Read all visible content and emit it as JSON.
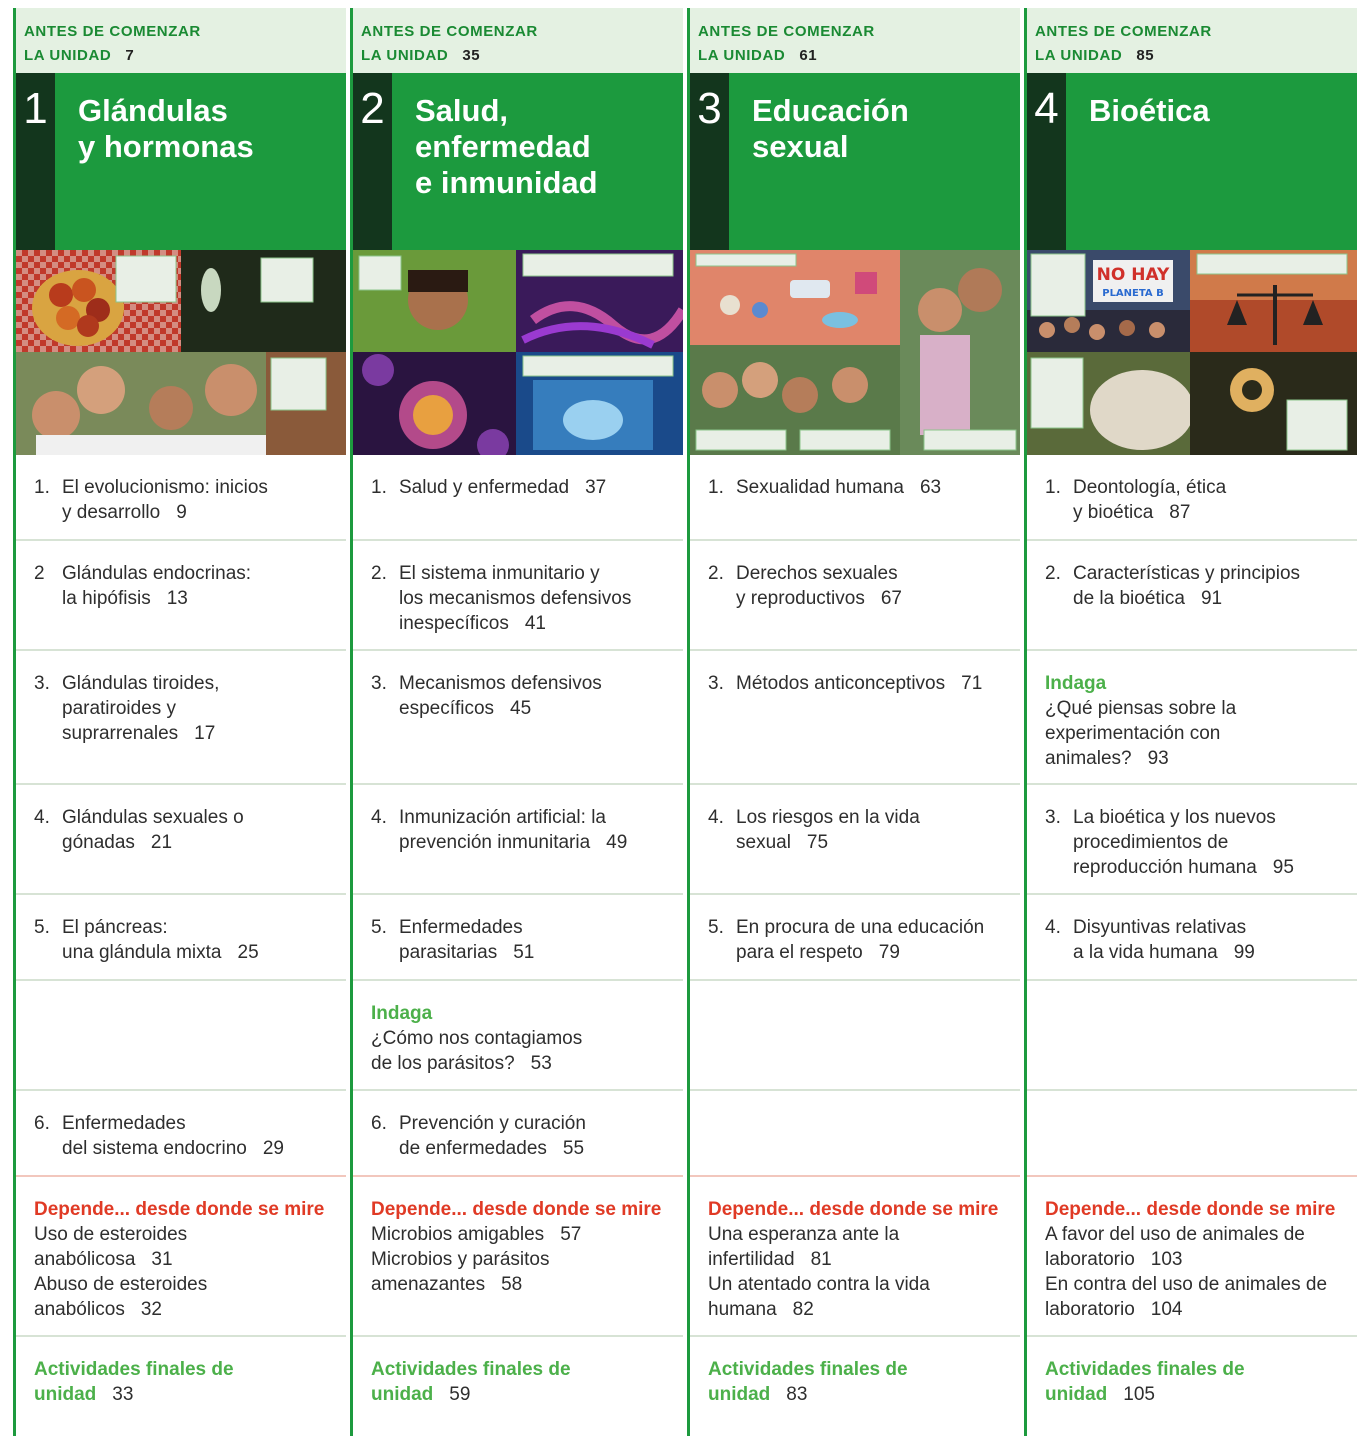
{
  "header_label_line1": "ANTES DE COMENZAR",
  "header_label_line2": "LA UNIDAD",
  "units": [
    {
      "number": "1",
      "before_page": "7",
      "title_lines": [
        "Glándulas",
        "y hormonas",
        ""
      ],
      "lessons": [
        {
          "n": "1.",
          "lines": [
            "El evolucionismo: inicios",
            "y desarrollo"
          ],
          "page": "9"
        },
        {
          "n": "2",
          "lines": [
            "Glándulas endocrinas:",
            "la hipófisis"
          ],
          "page": "13"
        },
        {
          "n": "3.",
          "lines": [
            "Glándulas tiroides,",
            "paratiroides y",
            "suprarrenales"
          ],
          "page": "17"
        },
        {
          "n": "4.",
          "lines": [
            "Glándulas sexuales o",
            "gónadas"
          ],
          "page": "21"
        },
        {
          "n": "5.",
          "lines": [
            "El páncreas:",
            "una glándula mixta"
          ],
          "page": "25"
        }
      ],
      "indaga": null,
      "lesson6": {
        "n": "6.",
        "lines": [
          "Enfermedades",
          "del sistema endocrino"
        ],
        "page": "29"
      },
      "depende_heading": "Depende... desde donde se mire",
      "depende_items": [
        {
          "lines": [
            "Uso de esteroides",
            "anabólicosa"
          ],
          "page": "31"
        },
        {
          "lines": [
            "Abuso de esteroides",
            "anabólicos"
          ],
          "page": "32"
        }
      ],
      "final_lines": [
        "Actividades finales de",
        "unidad"
      ],
      "final_page": "33"
    },
    {
      "number": "2",
      "before_page": "35",
      "title_lines": [
        "Salud,",
        "enfermedad",
        "e inmunidad"
      ],
      "lessons": [
        {
          "n": "1.",
          "lines": [
            "Salud y enfermedad"
          ],
          "page": "37"
        },
        {
          "n": "2.",
          "lines": [
            "El sistema inmunitario y",
            "los mecanismos defensivos",
            "inespecíficos"
          ],
          "page": "41"
        },
        {
          "n": "3.",
          "lines": [
            "Mecanismos defensivos",
            "específicos"
          ],
          "page": "45"
        },
        {
          "n": "4.",
          "lines": [
            "Inmunización artificial: la",
            "prevención inmunitaria"
          ],
          "page": "49"
        },
        {
          "n": "5.",
          "lines": [
            "Enfermedades",
            "parasitarias"
          ],
          "page": "51"
        }
      ],
      "indaga": {
        "label": "Indaga",
        "lines": [
          "¿Cómo nos contagiamos",
          "de los parásitos?"
        ],
        "page": "53"
      },
      "lesson6": {
        "n": "6.",
        "lines": [
          "Prevención y curación",
          "de enfermedades"
        ],
        "page": "55"
      },
      "depende_heading": "Depende... desde donde se mire",
      "depende_items": [
        {
          "lines": [
            "Microbios amigables"
          ],
          "page": "57"
        },
        {
          "lines": [
            "Microbios y parásitos",
            "amenazantes"
          ],
          "page": "58"
        }
      ],
      "final_lines": [
        "Actividades finales de",
        "unidad"
      ],
      "final_page": "59"
    },
    {
      "number": "3",
      "before_page": "61",
      "title_lines": [
        "Educación",
        "sexual",
        ""
      ],
      "lessons": [
        {
          "n": "1.",
          "lines": [
            "Sexualidad humana"
          ],
          "page": "63"
        },
        {
          "n": "2.",
          "lines": [
            "Derechos sexuales",
            "y reproductivos"
          ],
          "page": "67"
        },
        {
          "n": "3.",
          "lines": [
            "Métodos anticonceptivos"
          ],
          "page": "71"
        },
        {
          "n": "4.",
          "lines": [
            "Los riesgos en la vida",
            "sexual"
          ],
          "page": "75"
        },
        {
          "n": "5.",
          "lines": [
            "En procura de una educación",
            "para el respeto"
          ],
          "page": "79"
        }
      ],
      "indaga": null,
      "lesson6": null,
      "depende_heading": "Depende... desde donde se mire",
      "depende_items": [
        {
          "lines": [
            "Una esperanza ante la",
            "infertilidad"
          ],
          "page": "81"
        },
        {
          "lines": [
            "Un atentado contra la vida",
            "humana"
          ],
          "page": "82"
        }
      ],
      "final_lines": [
        "Actividades finales de",
        "unidad"
      ],
      "final_page": "83"
    },
    {
      "number": "4",
      "before_page": "85",
      "title_lines": [
        "Bioética",
        "",
        ""
      ],
      "lessons": [
        {
          "n": "1.",
          "lines": [
            "Deontología, ética",
            "y bioética"
          ],
          "page": "87"
        },
        {
          "n": "2.",
          "lines": [
            "Características y principios",
            "de la bioética"
          ],
          "page": "91"
        },
        {
          "indaga": true,
          "label": "Indaga",
          "lines": [
            "¿Qué piensas sobre la",
            "experimentación con",
            "animales?"
          ],
          "page": "93"
        },
        {
          "n": "3.",
          "lines": [
            "La bioética y los nuevos",
            "procedimientos de",
            "reproducción humana"
          ],
          "page": "95"
        },
        {
          "n": "4.",
          "lines": [
            "Disyuntivas relativas",
            "a la vida humana"
          ],
          "page": "99"
        }
      ],
      "indaga": null,
      "lesson6": null,
      "depende_heading": "Depende... desde donde se mire",
      "depende_items": [
        {
          "lines": [
            "A favor del uso de animales de",
            "laboratorio"
          ],
          "page": "103"
        },
        {
          "lines": [
            "En contra del uso de animales de",
            "laboratorio"
          ],
          "page": "104"
        }
      ],
      "final_lines": [
        "Actividades finales de",
        "unidad"
      ],
      "final_page": "105"
    }
  ],
  "photo_text": {
    "no_hay": "NO HAY",
    "planeta": "PLANETA B"
  },
  "colors": {
    "green": "#1c9a3e",
    "dark_green": "#13361d",
    "light_green_bg": "#e4f1e2",
    "indaga_green": "#4cb04a",
    "depende_red": "#e03a25"
  }
}
